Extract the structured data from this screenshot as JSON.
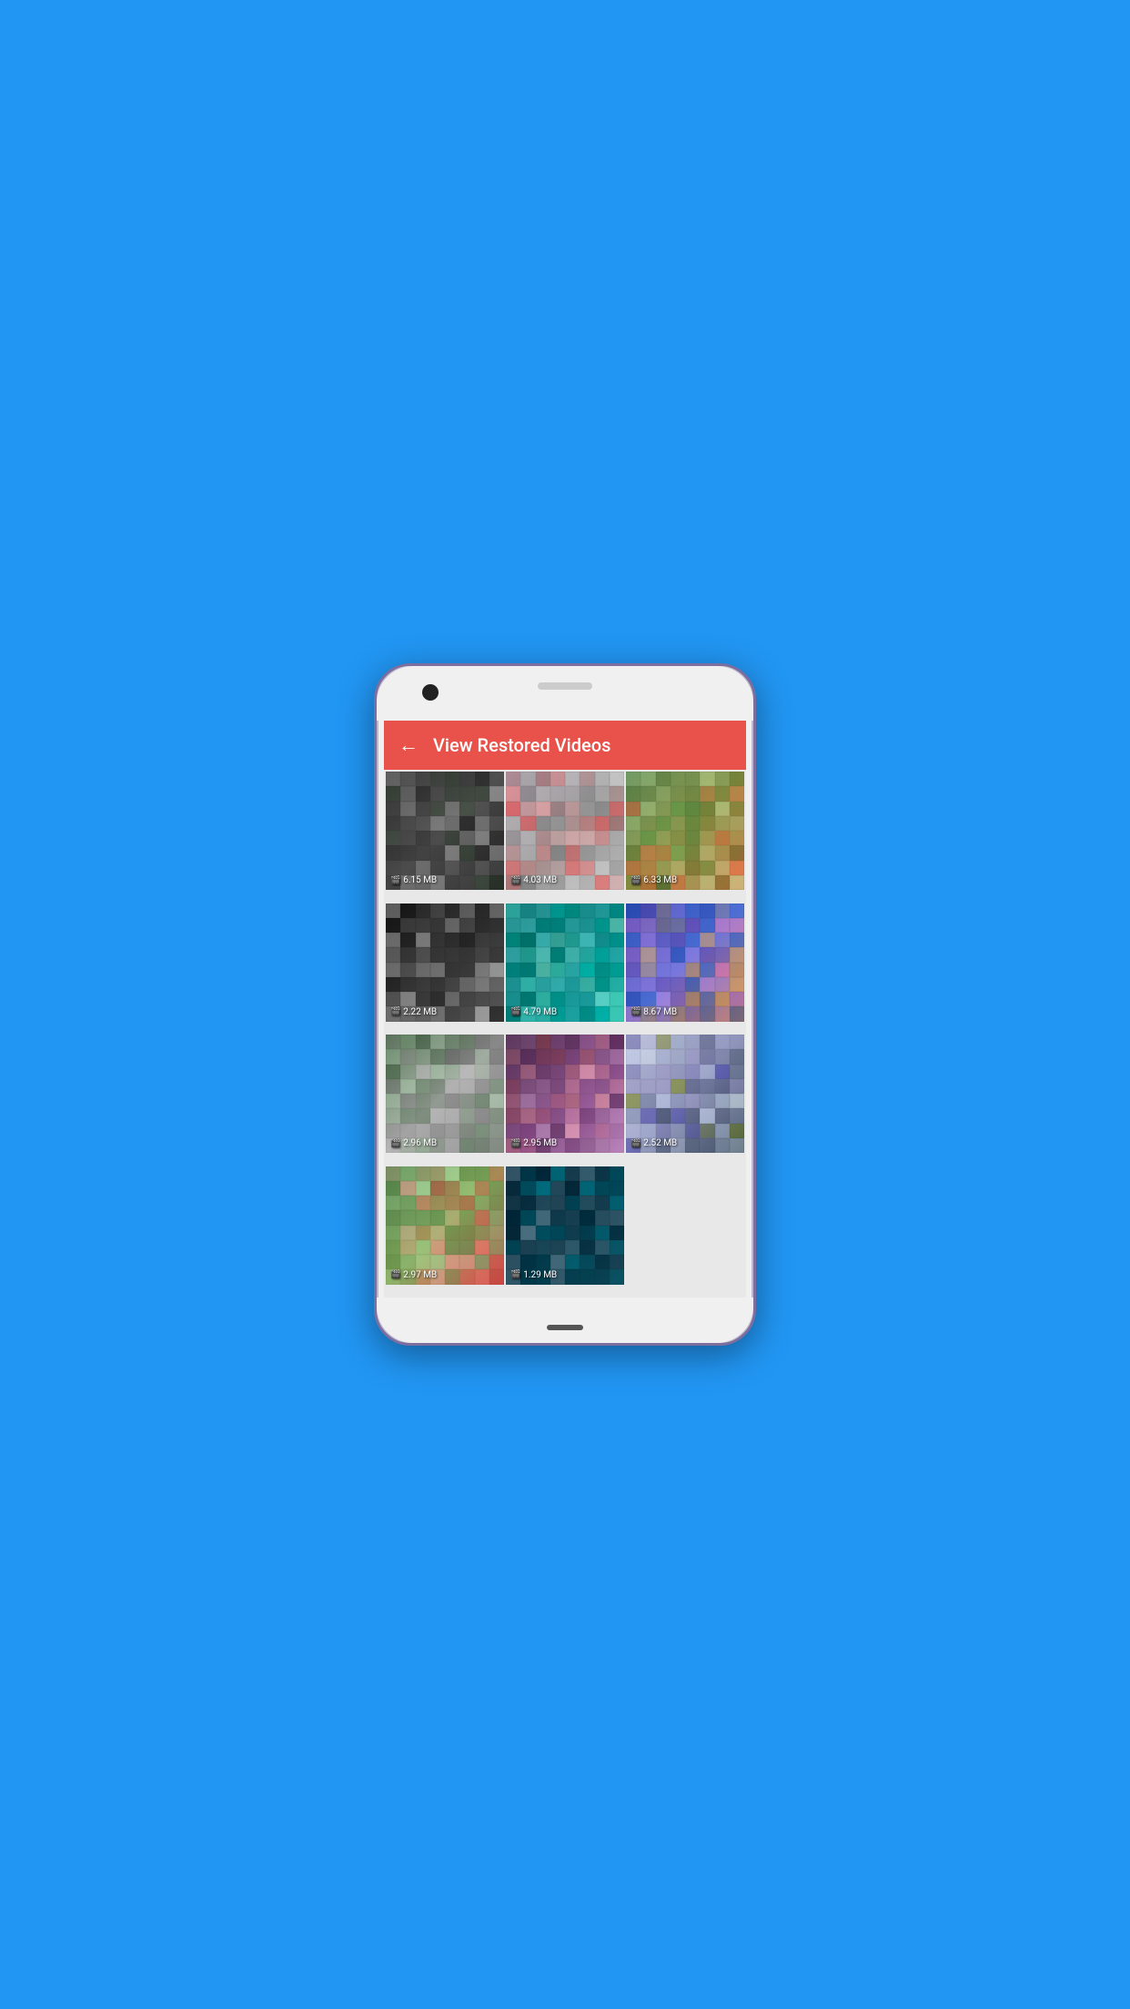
{
  "header": {
    "title": "View Restored Videos",
    "back_label": "←"
  },
  "videos": [
    {
      "id": 1,
      "size": "6.15 MB",
      "thumb_class": "thumb-1",
      "colors": [
        "#1a1a1a",
        "#2c2c2c",
        "#3d3d3d",
        "#4e4e4e",
        "#1a2b1a",
        "#2c3d2c",
        "#3d4e3d",
        "#555555",
        "#666666",
        "#333333",
        "#444444",
        "#222222",
        "#111111",
        "#777777",
        "#888888",
        "#aaaaaa"
      ]
    },
    {
      "id": 2,
      "size": "4.03 MB",
      "thumb_class": "thumb-2",
      "colors": [
        "#aaaaaa",
        "#bbbbbb",
        "#999999",
        "#dddddd",
        "#cccccc",
        "#eeeeee",
        "#888888",
        "#777777",
        "#ff8888",
        "#ffaaaa",
        "#ff6666",
        "#cc7777",
        "#aa5555",
        "#dd9999",
        "#ffbbbb",
        "#ff4444"
      ]
    },
    {
      "id": 3,
      "size": "6.33 MB",
      "thumb_class": "thumb-3",
      "colors": [
        "#336633",
        "#448844",
        "#55aa55",
        "#66bb66",
        "#cc5533",
        "#dd6644",
        "#ee7755",
        "#ff8866",
        "#5a7a3a",
        "#6b8b4b",
        "#7c9c5c",
        "#8dad6d",
        "#9ebe7e",
        "#afcf8f",
        "#c0e0a0",
        "#d1f1b1"
      ]
    },
    {
      "id": 4,
      "size": "2.22 MB",
      "thumb_class": "thumb-4",
      "colors": [
        "#111111",
        "#222222",
        "#333333",
        "#444444",
        "#555555",
        "#666666",
        "#777777",
        "#888888",
        "#999999",
        "#aaaaaa",
        "#bbbbbb",
        "#cccccc",
        "#1a1a1a",
        "#2b2b2b",
        "#3c3c3c",
        "#4d4d4d"
      ]
    },
    {
      "id": 5,
      "size": "4.79 MB",
      "thumb_class": "thumb-5",
      "colors": [
        "#007766",
        "#008877",
        "#009988",
        "#00aa99",
        "#00bbaa",
        "#00ccbb",
        "#55ddcc",
        "#66eecc",
        "#33aaaa",
        "#44bbbb",
        "#55cccc",
        "#66dddd",
        "#77eeee",
        "#88ffff",
        "#99ffee",
        "#aaffdd"
      ]
    },
    {
      "id": 6,
      "size": "8.67 MB",
      "thumb_class": "thumb-6",
      "colors": [
        "#2244aa",
        "#3355bb",
        "#4466cc",
        "#5577dd",
        "#cc8844",
        "#dd9955",
        "#eeaa66",
        "#ffbb77",
        "#8844aa",
        "#9955bb",
        "#aa66cc",
        "#bb77dd",
        "#cc88ee",
        "#dd99ff",
        "#ee88cc",
        "#ff77bb"
      ]
    },
    {
      "id": 7,
      "size": "2.96 MB",
      "thumb_class": "thumb-7",
      "colors": [
        "#3a5a3a",
        "#4b6b4b",
        "#5c7c5c",
        "#6d8d6d",
        "#7e9e7e",
        "#8faf8f",
        "#a0c0a0",
        "#b1d1b1",
        "#aaaaaa",
        "#bbbbbb",
        "#cccccc",
        "#999999",
        "#888888",
        "#777777",
        "#666666",
        "#555555"
      ]
    },
    {
      "id": 8,
      "size": "2.95 MB",
      "thumb_class": "thumb-8",
      "colors": [
        "#442244",
        "#553355",
        "#664466",
        "#775577",
        "#886688",
        "#997799",
        "#aa88aa",
        "#bb99bb",
        "#884444",
        "#995555",
        "#aa6666",
        "#bb7777",
        "#cc8888",
        "#dd9999",
        "#eeaaaa",
        "#ffbbbb"
      ]
    },
    {
      "id": 9,
      "size": "2.52 MB",
      "thumb_class": "thumb-9",
      "colors": [
        "#aaaacc",
        "#8888bb",
        "#6666aa",
        "#4444aa",
        "#334455",
        "#445566",
        "#556677",
        "#667788",
        "#778899",
        "#889900",
        "#99aabb",
        "#aabbcc",
        "#bbccdd",
        "#ccddee",
        "#ddeeff",
        "#eeffff"
      ]
    },
    {
      "id": 10,
      "size": "2.97 MB",
      "thumb_class": "thumb-10",
      "colors": [
        "#4a7a44",
        "#5b8b55",
        "#6c9c66",
        "#7dad77",
        "#8ebe88",
        "#9fcf99",
        "#b0e0aa",
        "#c1f1bb",
        "#cc4444",
        "#dd5555",
        "#ee6666",
        "#ff7777",
        "#ff8888",
        "#ff9999",
        "#ffaaaa",
        "#ffbbbb"
      ]
    },
    {
      "id": 11,
      "size": "1.29 MB",
      "thumb_class": "thumb-11",
      "colors": [
        "#002233",
        "#003344",
        "#004455",
        "#005566",
        "#006677",
        "#007788",
        "#008899",
        "#0099aa",
        "#0a2233",
        "#1a3344",
        "#2a4455",
        "#3a5566",
        "#4a6677",
        "#5a7788",
        "#6a8899",
        "#7a99aa"
      ]
    }
  ]
}
